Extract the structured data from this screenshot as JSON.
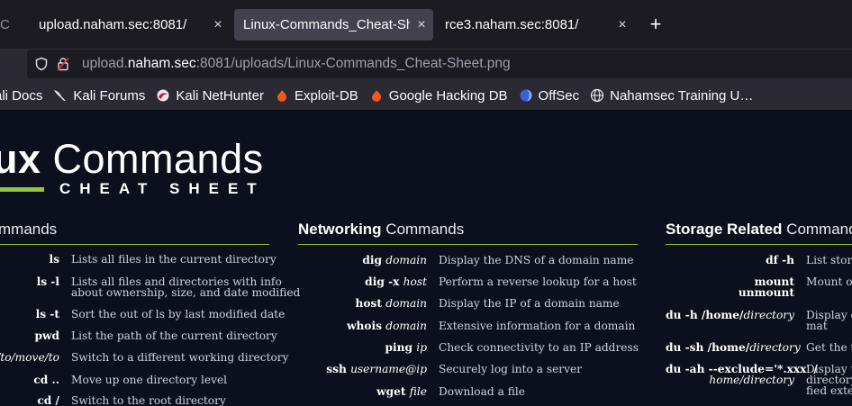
{
  "tabs": [
    {
      "title": "C",
      "close": "×"
    },
    {
      "title": "upload.naham.sec:8081/",
      "close": "×"
    },
    {
      "title": "Linux-Commands_Cheat-She",
      "close": "×"
    },
    {
      "title": "rce3.naham.sec:8081/",
      "close": "×"
    }
  ],
  "new_tab": "+",
  "url": {
    "pre": "upload.",
    "host": "naham.sec",
    "post": ":8081/uploads/Linux-Commands_Cheat-Sheet.png"
  },
  "bookmarks": [
    {
      "label": "ali Docs",
      "icon": "kali-icon"
    },
    {
      "label": "Kali Forums",
      "icon": "kali-dragon-icon"
    },
    {
      "label": "Kali NetHunter",
      "icon": "nethunter-icon"
    },
    {
      "label": "Exploit-DB",
      "icon": "exploitdb-icon"
    },
    {
      "label": "Google Hacking DB",
      "icon": "ghdb-icon"
    },
    {
      "label": "OffSec",
      "icon": "offsec-icon"
    },
    {
      "label": "Nahamsec Training U…",
      "icon": "globe-icon"
    }
  ],
  "image": {
    "logo_bold": "ux",
    "logo_rest": " Commands",
    "logo_sub": "CHEAT SHEET",
    "sections": [
      {
        "bold": "",
        "rest": "mmands",
        "rows": [
          {
            "cmd": "ls",
            "arg": "",
            "desc": "Lists all files in the current directory",
            "desc2": ""
          },
          {
            "cmd": "ls -l",
            "arg": "",
            "desc": "Lists all files and directories with info",
            "desc2": "about ownership, size, and date modified"
          },
          {
            "cmd": "ls -t",
            "arg": "",
            "desc": "Sort the out of ls by last modified date",
            "desc2": ""
          },
          {
            "cmd": "pwd",
            "arg": "",
            "desc": "List the path of the current directory",
            "desc2": ""
          },
          {
            "cmd": "",
            "arg": "y/to/move/to",
            "desc": "Switch to a different working directory",
            "desc2": ""
          },
          {
            "cmd": "cd ..",
            "arg": "",
            "desc": "Move up one directory level",
            "desc2": ""
          },
          {
            "cmd": "cd /",
            "arg": "",
            "desc": "Switch to the root directory",
            "desc2": ""
          }
        ]
      },
      {
        "bold": "Networking",
        "rest": " Commands",
        "rows": [
          {
            "cmd": "dig ",
            "arg": "domain",
            "desc": "Display the DNS of a domain name",
            "desc2": ""
          },
          {
            "cmd": "dig -x ",
            "arg": "host",
            "desc": "Perform a reverse lookup for a host",
            "desc2": ""
          },
          {
            "cmd": "host ",
            "arg": "domain",
            "desc": "Display the IP of a domain name",
            "desc2": ""
          },
          {
            "cmd": "whois ",
            "arg": "domain",
            "desc": "Extensive information for a domain",
            "desc2": ""
          },
          {
            "cmd": "ping ",
            "arg": "ip",
            "desc": "Check connectivity to an IP address",
            "desc2": ""
          },
          {
            "cmd": "ssh ",
            "arg": "username@ip",
            "desc": "Securely log into a server",
            "desc2": ""
          },
          {
            "cmd": "wget ",
            "arg": "file",
            "desc": "Download a file",
            "desc2": ""
          }
        ]
      },
      {
        "bold": "Storage Related",
        "rest": " Command",
        "rows": [
          {
            "cmd": "df -h",
            "arg": "",
            "cmd2": "",
            "arg2": "",
            "desc": "List storag",
            "desc2": ""
          },
          {
            "cmd": "mount",
            "arg": "",
            "cmd2": "unmount",
            "arg2": "",
            "desc": "Mount or",
            "desc2": ""
          },
          {
            "cmd": "du -h /home/",
            "arg": "directory",
            "cmd2": "",
            "arg2": "",
            "desc": "Display d",
            "desc2": "mat"
          },
          {
            "cmd": "du -sh /home/",
            "arg": "directory",
            "cmd2": "",
            "arg2": "",
            "desc": "Get the to",
            "desc2": ""
          },
          {
            "cmd": "du -ah --exclude='*.xxx' /",
            "arg": "",
            "cmd2": "",
            "arg2": "home/directory",
            "desc": "Display th",
            "desc2": "directory,",
            "desc3": "fied exten"
          }
        ]
      }
    ]
  }
}
